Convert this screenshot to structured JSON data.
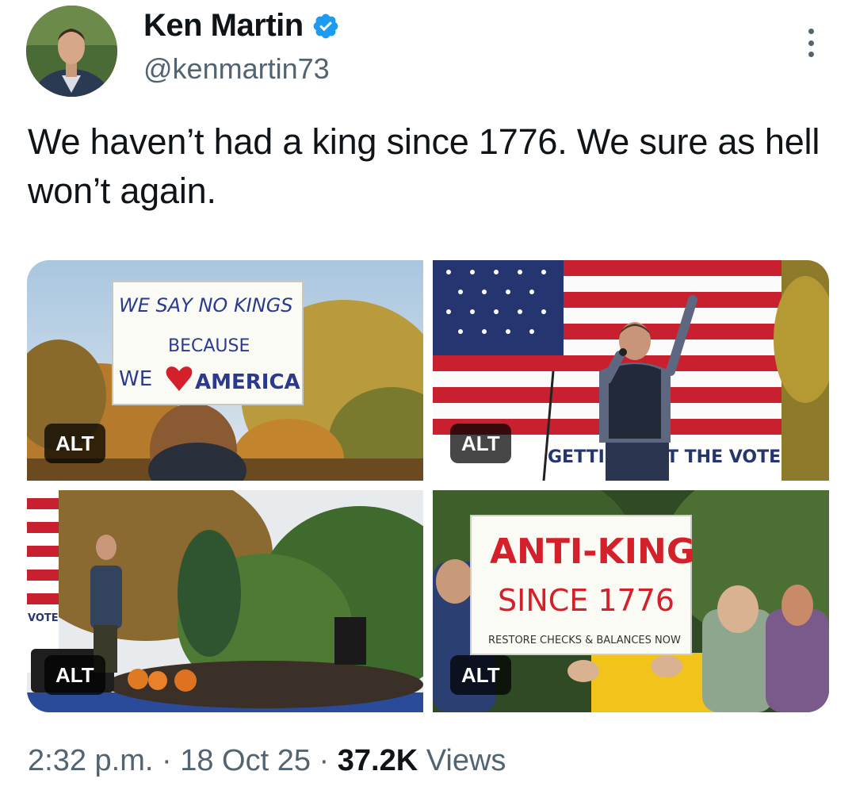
{
  "author": {
    "display_name": "Ken Martin",
    "handle": "@kenmartin73",
    "verified": true,
    "verified_icon": "verified-badge-icon",
    "avatar_icon": "profile-photo"
  },
  "tweet": {
    "text": "We haven’t had a king since 1776. We sure as hell won’t again."
  },
  "media": {
    "alt_label": "ALT",
    "photos": [
      {
        "name": "photo-no-kings-sign",
        "sign_lines": [
          "WE SAY NO KINGS",
          "BECAUSE",
          "WE",
          "AMERICA"
        ]
      },
      {
        "name": "photo-speaker-flag",
        "banner_left": "GETTII",
        "banner_right": "T THE VOTE"
      },
      {
        "name": "photo-rally-crowd",
        "flag_text": "VOTE"
      },
      {
        "name": "photo-anti-king-sign",
        "sign_line1": "ANTI-KING",
        "sign_line2": "SINCE 1776",
        "sign_line3": "RESTORE CHECKS & BALANCES NOW"
      }
    ]
  },
  "meta": {
    "time": "2:32 p.m.",
    "separator": "·",
    "date": "18 Oct 25",
    "views_count": "37.2K",
    "views_label": "Views"
  },
  "colors": {
    "text_primary": "#0f1419",
    "text_secondary": "#536471",
    "verified_blue": "#1d9bf0"
  }
}
